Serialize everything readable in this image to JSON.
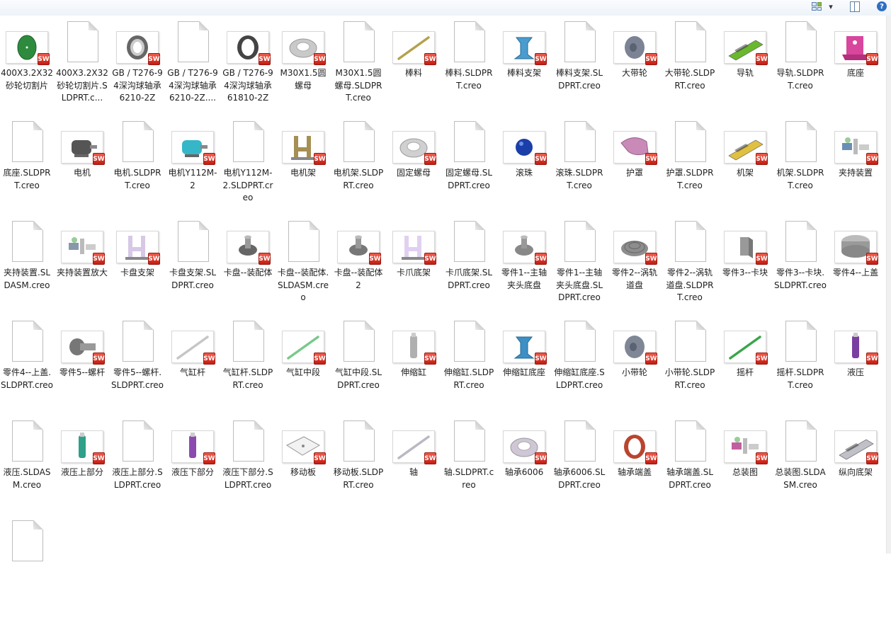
{
  "toolbar": {
    "views_icon": "view-options-icon",
    "preview_icon": "preview-pane-icon",
    "help_icon": "help-icon",
    "help_glyph": "?",
    "dropdown_glyph": "▾"
  },
  "badge_text": "SW",
  "files": [
    {
      "name": "400X3.2X32砂轮切割片",
      "kind": "part",
      "shape": "disc",
      "color": "#2e8b3e"
    },
    {
      "name": "400X3.2X32砂轮切割片.SLDPRT.c...",
      "kind": "blank"
    },
    {
      "name": "GB / T276-94深沟球轴承6210-2Z",
      "kind": "part",
      "shape": "bearing",
      "color": "#555555"
    },
    {
      "name": "GB / T276-94深沟球轴承6210-2Z....",
      "kind": "blank"
    },
    {
      "name": "GB / T276-94深沟球轴承61810-2Z",
      "kind": "part",
      "shape": "ring",
      "color": "#444444"
    },
    {
      "name": "M30X1.5圆螺母",
      "kind": "part",
      "shape": "flatring",
      "color": "#c9c9c9"
    },
    {
      "name": "M30X1.5圆螺母.SLDPRT.creo",
      "kind": "blank"
    },
    {
      "name": "棒料",
      "kind": "part",
      "shape": "rod",
      "color": "#b5a14b"
    },
    {
      "name": "棒料.SLDPRT.creo",
      "kind": "blank"
    },
    {
      "name": "棒料支架",
      "kind": "part",
      "shape": "bracket",
      "color": "#4a9ccf"
    },
    {
      "name": "棒料支架.SLDPRT.creo",
      "kind": "blank"
    },
    {
      "name": "大带轮",
      "kind": "part",
      "shape": "pulley",
      "color": "#7b8394"
    },
    {
      "name": "大带轮.SLDPRT.creo",
      "kind": "blank"
    },
    {
      "name": "导轨",
      "kind": "part",
      "shape": "rail",
      "color": "#6ab82e"
    },
    {
      "name": "导轨.SLDPRT.creo",
      "kind": "blank"
    },
    {
      "name": "底座",
      "kind": "part",
      "shape": "base",
      "color": "#d8469d"
    },
    {
      "name": "底座.SLDPRT.creo",
      "kind": "blank"
    },
    {
      "name": "电机",
      "kind": "part",
      "shape": "motor",
      "color": "#555555"
    },
    {
      "name": "电机.SLDPRT.creo",
      "kind": "blank"
    },
    {
      "name": "电机Y112M-2",
      "kind": "part",
      "shape": "motor",
      "color": "#36b6c9"
    },
    {
      "name": "电机Y112M-2.SLDPRT.creo",
      "kind": "blank"
    },
    {
      "name": "电机架",
      "kind": "part",
      "shape": "frame",
      "color": "#a58f52"
    },
    {
      "name": "电机架.SLDPRT.creo",
      "kind": "blank"
    },
    {
      "name": "固定螺母",
      "kind": "part",
      "shape": "flatring",
      "color": "#d0d0d0"
    },
    {
      "name": "固定螺母.SLDPRT.creo",
      "kind": "blank"
    },
    {
      "name": "滚珠",
      "kind": "part",
      "shape": "ball",
      "color": "#1b3fa8"
    },
    {
      "name": "滚珠.SLDPRT.creo",
      "kind": "blank"
    },
    {
      "name": "护罩",
      "kind": "part",
      "shape": "guard",
      "color": "#c98ab8"
    },
    {
      "name": "护罩.SLDPRT.creo",
      "kind": "blank"
    },
    {
      "name": "机架",
      "kind": "part",
      "shape": "rail",
      "color": "#e0c040"
    },
    {
      "name": "机架.SLDPRT.creo",
      "kind": "blank"
    },
    {
      "name": "夹持装置",
      "kind": "part",
      "shape": "assembly",
      "color": "#6a8fb5"
    },
    {
      "name": "夹持装置.SLDASM.creo",
      "kind": "blank"
    },
    {
      "name": "夹持装置放大",
      "kind": "part",
      "shape": "assembly",
      "color": "#8899aa"
    },
    {
      "name": "卡盘支架",
      "kind": "part",
      "shape": "frame",
      "color": "#d6c8e6"
    },
    {
      "name": "卡盘支架.SLDPRT.creo",
      "kind": "blank"
    },
    {
      "name": "卡盘--装配体",
      "kind": "part",
      "shape": "chuck",
      "color": "#666666"
    },
    {
      "name": "卡盘--装配体.SLDASM.creo",
      "kind": "blank"
    },
    {
      "name": "卡盘--装配体2",
      "kind": "part",
      "shape": "chuck",
      "color": "#777777"
    },
    {
      "name": "卡爪底架",
      "kind": "part",
      "shape": "frame",
      "color": "#e0d0f0"
    },
    {
      "name": "卡爪底架.SLDPRT.creo",
      "kind": "blank"
    },
    {
      "name": "零件1--主轴夹头底盘",
      "kind": "part",
      "shape": "chuck",
      "color": "#888888"
    },
    {
      "name": "零件1--主轴夹头底盘.SLDPRT.creo",
      "kind": "blank"
    },
    {
      "name": "零件2--涡轨道盘",
      "kind": "part",
      "shape": "spiral",
      "color": "#8d8d8d"
    },
    {
      "name": "零件2--涡轨道盘.SLDPRT.creo",
      "kind": "blank"
    },
    {
      "name": "零件3--卡块",
      "kind": "part",
      "shape": "block",
      "color": "#999999"
    },
    {
      "name": "零件3--卡块.SLDPRT.creo",
      "kind": "blank"
    },
    {
      "name": "零件4--上盖",
      "kind": "part",
      "shape": "cap",
      "color": "#9a9a9a"
    },
    {
      "name": "零件4--上盖.SLDPRT.creo",
      "kind": "blank"
    },
    {
      "name": "零件5--螺杆",
      "kind": "part",
      "shape": "bolt",
      "color": "#777777"
    },
    {
      "name": "零件5--螺杆.SLDPRT.creo",
      "kind": "blank"
    },
    {
      "name": "气缸杆",
      "kind": "part",
      "shape": "rod",
      "color": "#c6c6c6"
    },
    {
      "name": "气缸杆.SLDPRT.creo",
      "kind": "blank"
    },
    {
      "name": "气缸中段",
      "kind": "part",
      "shape": "rod",
      "color": "#79c98a"
    },
    {
      "name": "气缸中段.SLDPRT.creo",
      "kind": "blank"
    },
    {
      "name": "伸缩缸",
      "kind": "part",
      "shape": "cylinder",
      "color": "#b0b0b0"
    },
    {
      "name": "伸缩缸.SLDPRT.creo",
      "kind": "blank"
    },
    {
      "name": "伸缩缸底座",
      "kind": "part",
      "shape": "bracket",
      "color": "#3d8fc4"
    },
    {
      "name": "伸缩缸底座.SLDPRT.creo",
      "kind": "blank"
    },
    {
      "name": "小带轮",
      "kind": "part",
      "shape": "pulley",
      "color": "#7f8796"
    },
    {
      "name": "小带轮.SLDPRT.creo",
      "kind": "blank"
    },
    {
      "name": "摇杆",
      "kind": "part",
      "shape": "rod",
      "color": "#3aa54a"
    },
    {
      "name": "摇杆.SLDPRT.creo",
      "kind": "blank"
    },
    {
      "name": "液压",
      "kind": "part",
      "shape": "cylinder",
      "color": "#7a3fa0"
    },
    {
      "name": "液压.SLDASM.creo",
      "kind": "blank"
    },
    {
      "name": "液压上部分",
      "kind": "part",
      "shape": "cylinder",
      "color": "#2fa08a"
    },
    {
      "name": "液压上部分.SLDPRT.creo",
      "kind": "blank"
    },
    {
      "name": "液压下部分",
      "kind": "part",
      "shape": "cylinder",
      "color": "#8c4ab0"
    },
    {
      "name": "液压下部分.SLDPRT.creo",
      "kind": "blank"
    },
    {
      "name": "移动板",
      "kind": "part",
      "shape": "plate",
      "color": "#d9d9d9"
    },
    {
      "name": "移动板.SLDPRT.creo",
      "kind": "blank"
    },
    {
      "name": "轴",
      "kind": "part",
      "shape": "rod",
      "color": "#b9b9c4"
    },
    {
      "name": "轴.SLDPRT.creo",
      "kind": "blank"
    },
    {
      "name": "轴承6006",
      "kind": "part",
      "shape": "flatring",
      "color": "#cfc6d6"
    },
    {
      "name": "轴承6006.SLDPRT.creo",
      "kind": "blank"
    },
    {
      "name": "轴承端盖",
      "kind": "part",
      "shape": "ring",
      "color": "#b9452e"
    },
    {
      "name": "轴承端盖.SLDPRT.creo",
      "kind": "blank"
    },
    {
      "name": "总装图",
      "kind": "part",
      "shape": "assembly",
      "color": "#c060a0"
    },
    {
      "name": "总装图.SLDASM.creo",
      "kind": "blank"
    },
    {
      "name": "纵向底架",
      "kind": "part",
      "shape": "rail",
      "color": "#c0c0c8"
    },
    {
      "name": "",
      "kind": "blank"
    }
  ]
}
